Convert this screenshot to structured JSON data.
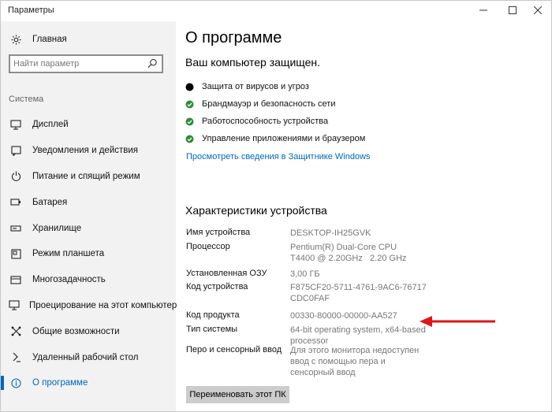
{
  "window": {
    "title": "Параметры"
  },
  "sidebar": {
    "home": "Главная",
    "search_placeholder": "Найти параметр",
    "section": "Система",
    "items": [
      {
        "label": "Дисплей",
        "icon": "display-icon"
      },
      {
        "label": "Уведомления и действия",
        "icon": "notifications-icon"
      },
      {
        "label": "Питание и спящий режим",
        "icon": "power-icon"
      },
      {
        "label": "Батарея",
        "icon": "battery-icon"
      },
      {
        "label": "Хранилище",
        "icon": "storage-icon"
      },
      {
        "label": "Режим планшета",
        "icon": "tablet-icon"
      },
      {
        "label": "Многозадачность",
        "icon": "multitasking-icon"
      },
      {
        "label": "Проецирование на этот компьютер",
        "icon": "projecting-icon"
      },
      {
        "label": "Общие возможности",
        "icon": "shared-icon"
      },
      {
        "label": "Удаленный рабочий стол",
        "icon": "remote-desktop-icon"
      },
      {
        "label": "О программе",
        "icon": "info-icon",
        "active": true
      }
    ]
  },
  "main": {
    "title": "О программе",
    "protected": "Ваш компьютер защищен.",
    "security": [
      {
        "label": "Защита от вирусов и угроз",
        "status": "black"
      },
      {
        "label": "Брандмауэр и безопасность сети",
        "status": "ok"
      },
      {
        "label": "Работоспособность устройства",
        "status": "ok"
      },
      {
        "label": "Управление приложениями и браузером",
        "status": "ok"
      }
    ],
    "defender_link": "Просмотреть сведения в Защитнике Windows",
    "specs_title": "Характеристики устройства",
    "specs": [
      {
        "key": "Имя устройства",
        "value": "DESKTOP-IH25GVK"
      },
      {
        "key": "Процессор",
        "value": "Pentium(R) Dual-Core CPU       T4400 @ 2.20GHz   2.20 GHz"
      },
      {
        "key": "Установленная ОЗУ",
        "value": "3,00 ГБ"
      },
      {
        "key": "Код устройства",
        "value": "F875CF20-5711-4761-9AC6-76717CDC0FAF"
      },
      {
        "key": "Код продукта",
        "value": "00330-80000-00000-AA527"
      },
      {
        "key": "Тип системы",
        "value": "64-bit operating system, x64-based processor"
      },
      {
        "key": "Перо и сенсорный ввод",
        "value": "Для этого монитора недоступен ввод с помощью пера и сенсорный ввод"
      }
    ],
    "rename_button": "Переименовать этот ПК"
  },
  "colors": {
    "accent": "#0067b8",
    "ok": "#2e8b3a",
    "arrow": "#e0141e",
    "sidebar_bg": "#f2f2f2"
  }
}
